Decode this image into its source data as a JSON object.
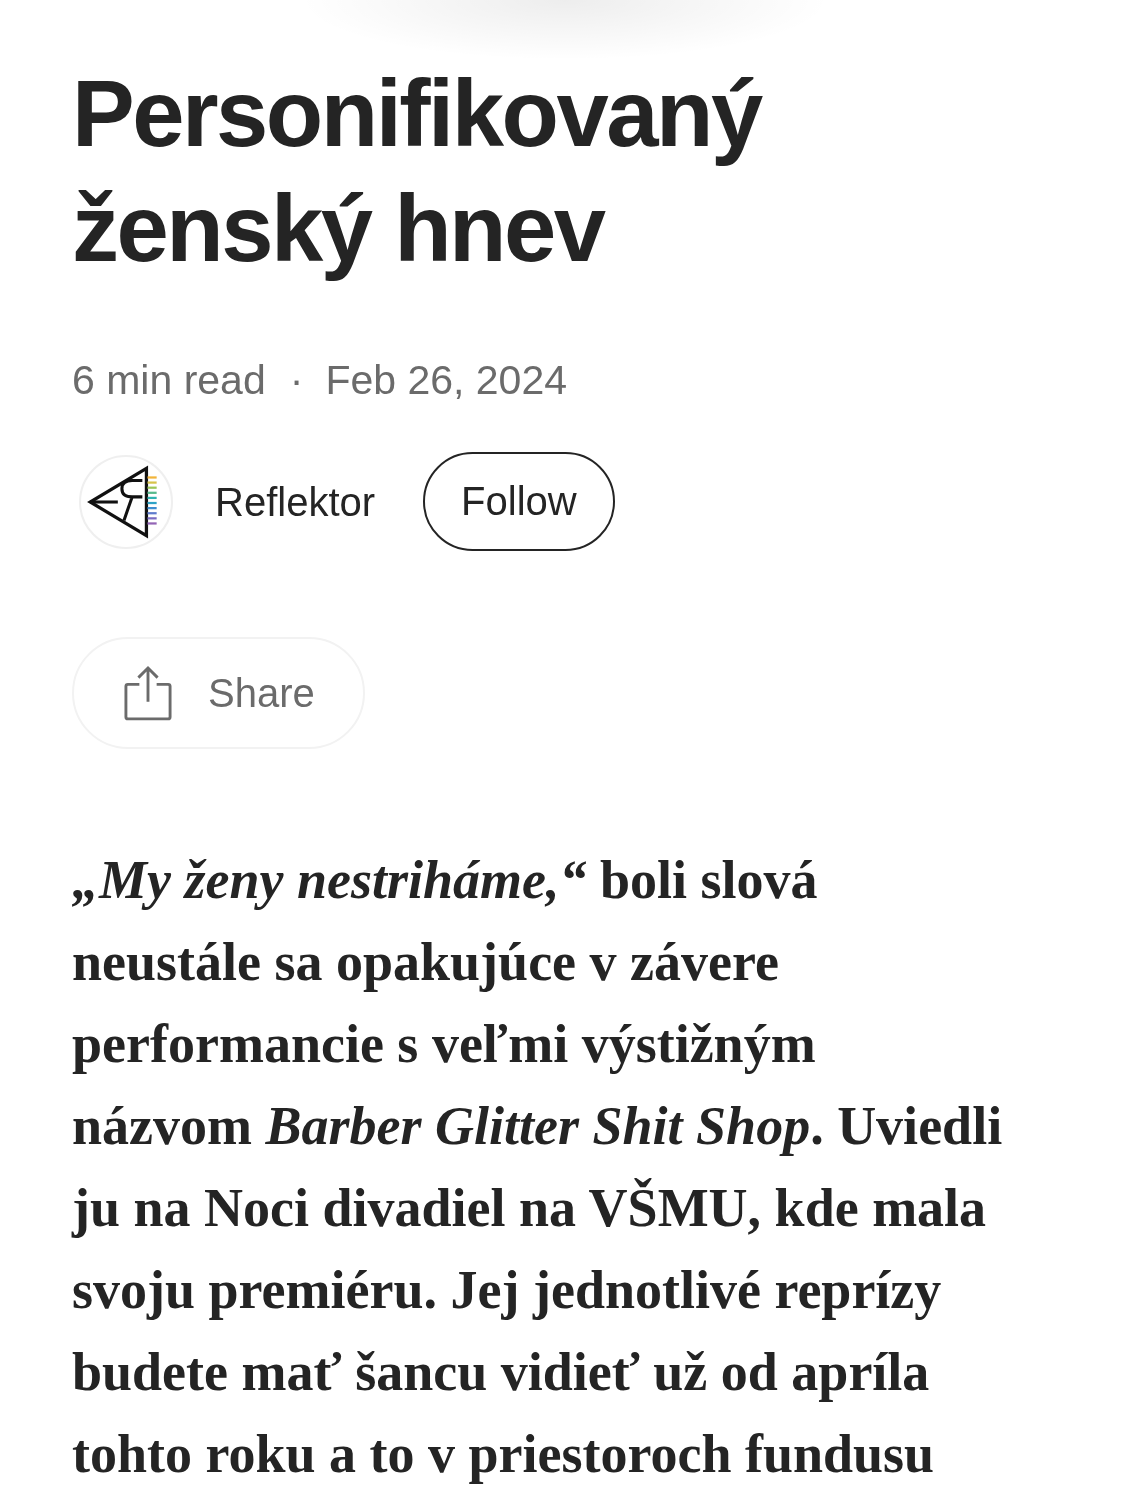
{
  "article": {
    "title": "Personifikovaný ženský hnev",
    "read_time": "6 min read",
    "separator": "·",
    "date": "Feb 26, 2024"
  },
  "author": {
    "name": "Reflektor",
    "follow_button": "Follow"
  },
  "share_button": {
    "label": "Share"
  },
  "body": {
    "paragraphs": [
      "*„My ženy nestriháme,“* boli slová neustále sa opakujúce v závere performancie s veľmi výstižným názvom *Barber Glitter Shit Shop*. Uviedli ju na Noci divadiel na VŠMU, kde mala svoju premiéru. Jej jednotlivé reprízy budete mať šancu vidieť už od apríla tohto roku a to v priestoroch fundusu"
    ]
  }
}
